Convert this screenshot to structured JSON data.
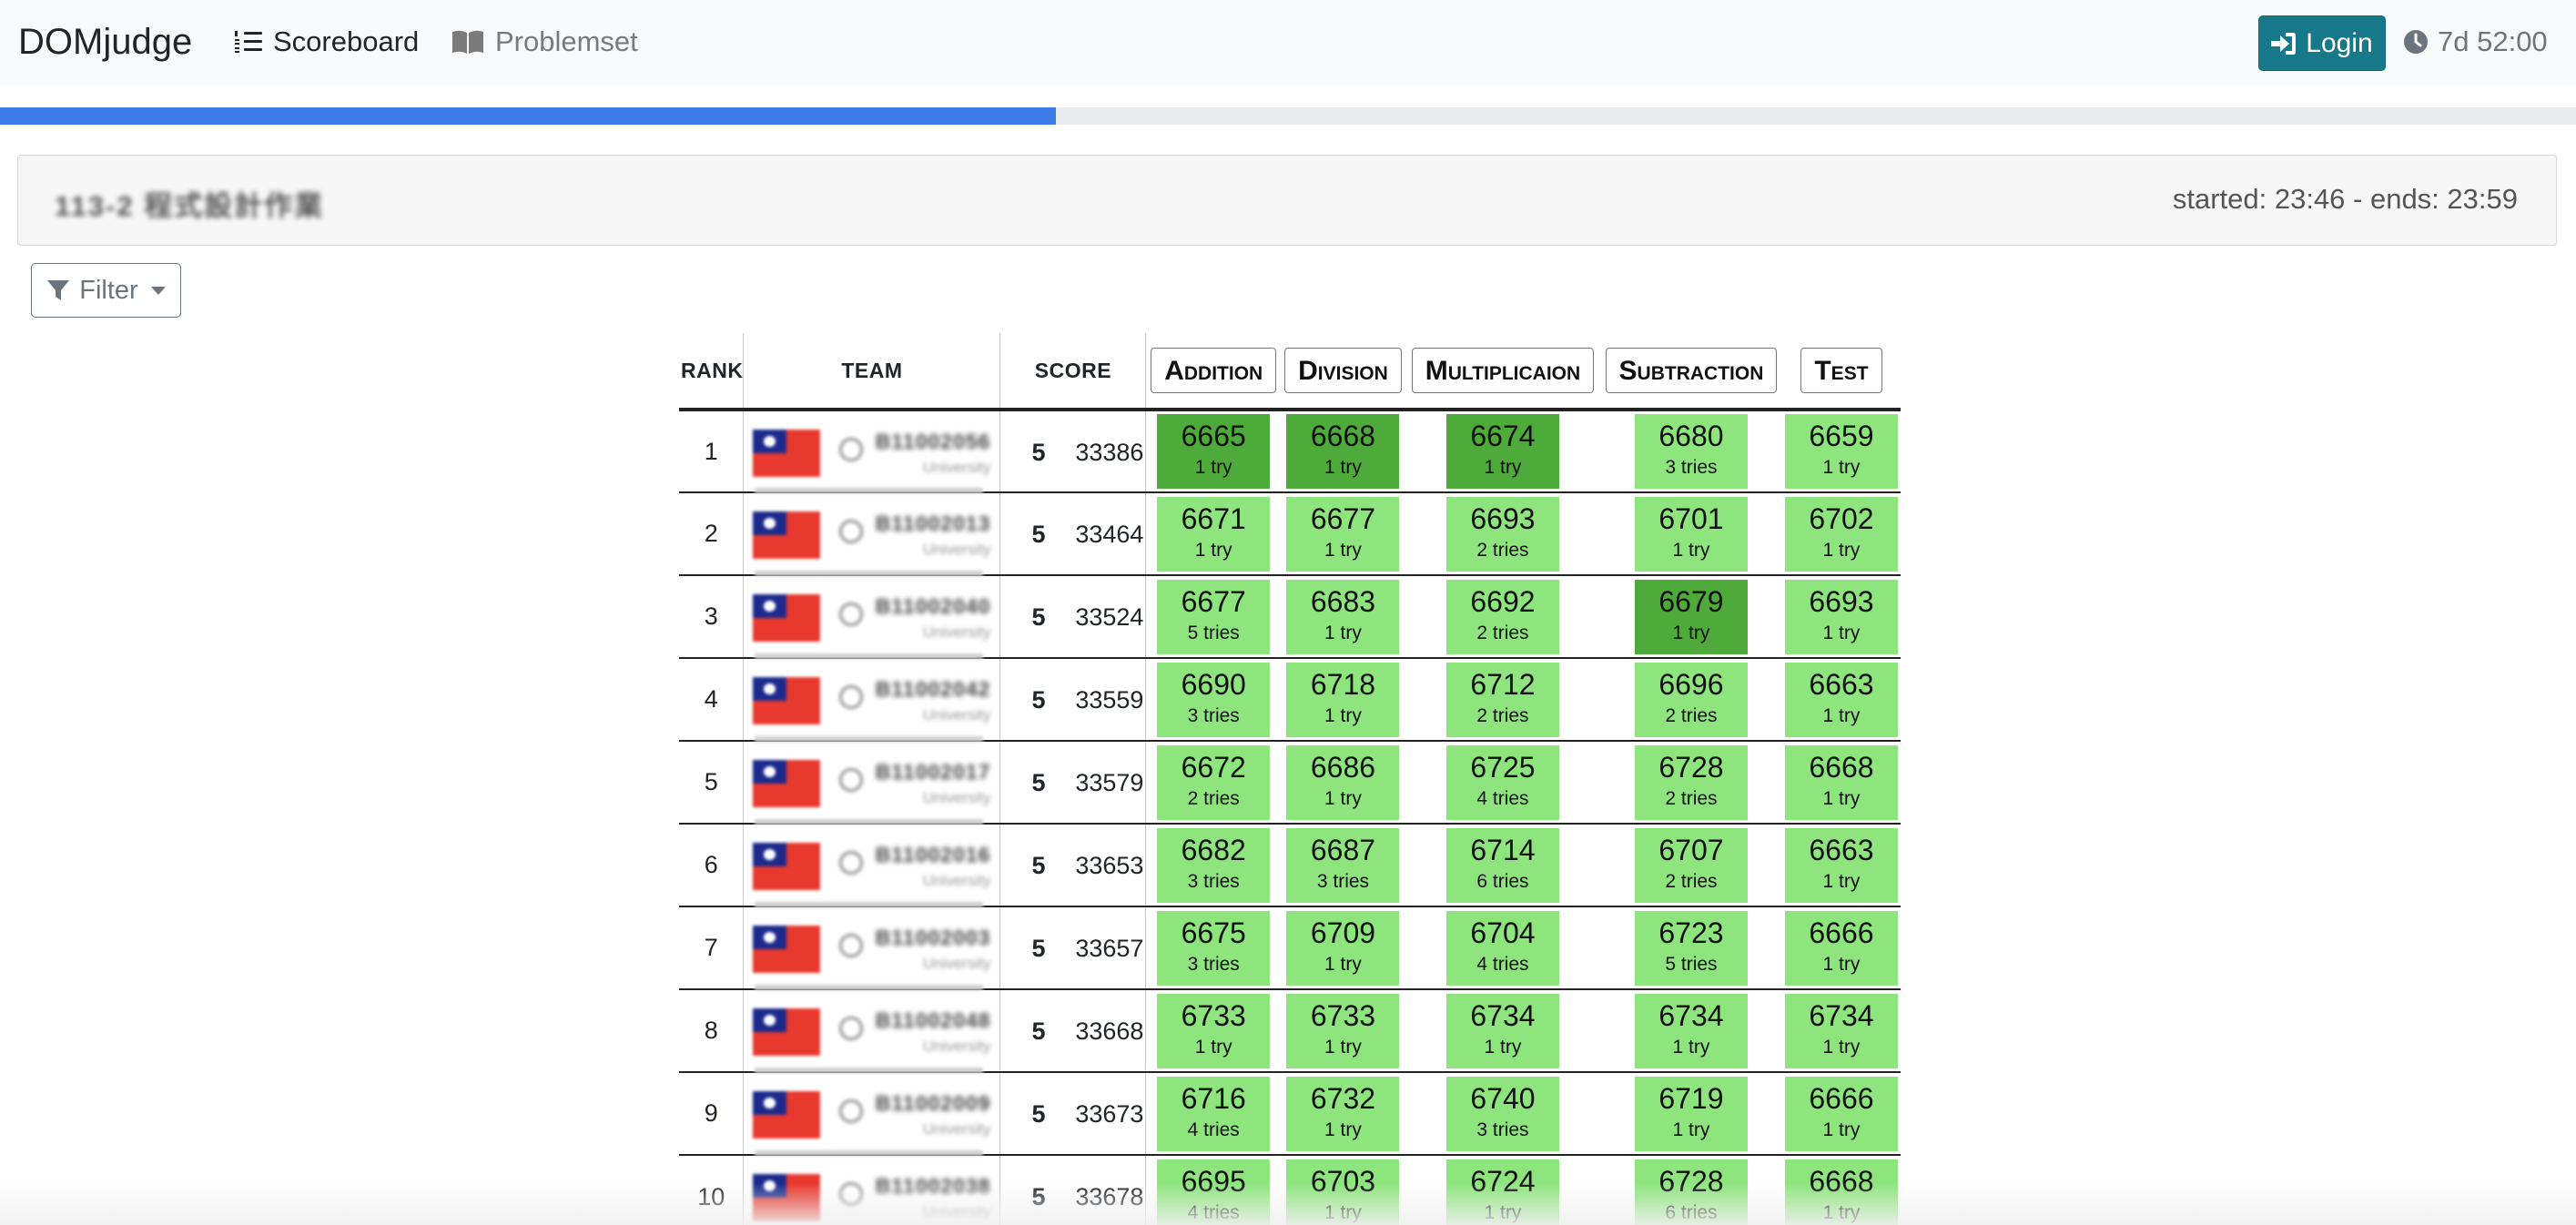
{
  "nav": {
    "brand": "DOMjudge",
    "scoreboard_label": "Scoreboard",
    "problemset_label": "Problemset",
    "login_label": "Login",
    "clock_text": "7d 52:00"
  },
  "progress": {
    "fraction": 0.41
  },
  "contest": {
    "name": "113-2 程式設計作業",
    "time_text": "started: 23:46 - ends: 23:59"
  },
  "filter": {
    "label": "Filter"
  },
  "table": {
    "headers": {
      "rank": "RANK",
      "team": "TEAM",
      "score": "SCORE"
    },
    "problems": [
      "Addition",
      "Division",
      "Multiplicaion",
      "Subtraction",
      "Test"
    ],
    "problem_col_widths": [
      148,
      137,
      214,
      200,
      130
    ],
    "rows": [
      {
        "rank": "1",
        "team": "B11002056",
        "uni": "University",
        "solved": "5",
        "penalty": "33386",
        "cells": [
          {
            "time": "6665",
            "tries": "1 try",
            "first": true
          },
          {
            "time": "6668",
            "tries": "1 try",
            "first": true
          },
          {
            "time": "6674",
            "tries": "1 try",
            "first": true
          },
          {
            "time": "6680",
            "tries": "3 tries",
            "first": false
          },
          {
            "time": "6659",
            "tries": "1 try",
            "first": false
          }
        ]
      },
      {
        "rank": "2",
        "team": "B11002013",
        "uni": "University",
        "solved": "5",
        "penalty": "33464",
        "cells": [
          {
            "time": "6671",
            "tries": "1 try",
            "first": false
          },
          {
            "time": "6677",
            "tries": "1 try",
            "first": false
          },
          {
            "time": "6693",
            "tries": "2 tries",
            "first": false
          },
          {
            "time": "6701",
            "tries": "1 try",
            "first": false
          },
          {
            "time": "6702",
            "tries": "1 try",
            "first": false
          }
        ]
      },
      {
        "rank": "3",
        "team": "B11002040",
        "uni": "University",
        "solved": "5",
        "penalty": "33524",
        "cells": [
          {
            "time": "6677",
            "tries": "5 tries",
            "first": false
          },
          {
            "time": "6683",
            "tries": "1 try",
            "first": false
          },
          {
            "time": "6692",
            "tries": "2 tries",
            "first": false
          },
          {
            "time": "6679",
            "tries": "1 try",
            "first": true
          },
          {
            "time": "6693",
            "tries": "1 try",
            "first": false
          }
        ]
      },
      {
        "rank": "4",
        "team": "B11002042",
        "uni": "University",
        "solved": "5",
        "penalty": "33559",
        "cells": [
          {
            "time": "6690",
            "tries": "3 tries",
            "first": false
          },
          {
            "time": "6718",
            "tries": "1 try",
            "first": false
          },
          {
            "time": "6712",
            "tries": "2 tries",
            "first": false
          },
          {
            "time": "6696",
            "tries": "2 tries",
            "first": false
          },
          {
            "time": "6663",
            "tries": "1 try",
            "first": false
          }
        ]
      },
      {
        "rank": "5",
        "team": "B11002017",
        "uni": "University",
        "solved": "5",
        "penalty": "33579",
        "cells": [
          {
            "time": "6672",
            "tries": "2 tries",
            "first": false
          },
          {
            "time": "6686",
            "tries": "1 try",
            "first": false
          },
          {
            "time": "6725",
            "tries": "4 tries",
            "first": false
          },
          {
            "time": "6728",
            "tries": "2 tries",
            "first": false
          },
          {
            "time": "6668",
            "tries": "1 try",
            "first": false
          }
        ]
      },
      {
        "rank": "6",
        "team": "B11002016",
        "uni": "University",
        "solved": "5",
        "penalty": "33653",
        "cells": [
          {
            "time": "6682",
            "tries": "3 tries",
            "first": false
          },
          {
            "time": "6687",
            "tries": "3 tries",
            "first": false
          },
          {
            "time": "6714",
            "tries": "6 tries",
            "first": false
          },
          {
            "time": "6707",
            "tries": "2 tries",
            "first": false
          },
          {
            "time": "6663",
            "tries": "1 try",
            "first": false
          }
        ]
      },
      {
        "rank": "7",
        "team": "B11002003",
        "uni": "University",
        "solved": "5",
        "penalty": "33657",
        "cells": [
          {
            "time": "6675",
            "tries": "3 tries",
            "first": false
          },
          {
            "time": "6709",
            "tries": "1 try",
            "first": false
          },
          {
            "time": "6704",
            "tries": "4 tries",
            "first": false
          },
          {
            "time": "6723",
            "tries": "5 tries",
            "first": false
          },
          {
            "time": "6666",
            "tries": "1 try",
            "first": false
          }
        ]
      },
      {
        "rank": "8",
        "team": "B11002048",
        "uni": "University",
        "solved": "5",
        "penalty": "33668",
        "cells": [
          {
            "time": "6733",
            "tries": "1 try",
            "first": false
          },
          {
            "time": "6733",
            "tries": "1 try",
            "first": false
          },
          {
            "time": "6734",
            "tries": "1 try",
            "first": false
          },
          {
            "time": "6734",
            "tries": "1 try",
            "first": false
          },
          {
            "time": "6734",
            "tries": "1 try",
            "first": false
          }
        ]
      },
      {
        "rank": "9",
        "team": "B11002009",
        "uni": "University",
        "solved": "5",
        "penalty": "33673",
        "cells": [
          {
            "time": "6716",
            "tries": "4 tries",
            "first": false
          },
          {
            "time": "6732",
            "tries": "1 try",
            "first": false
          },
          {
            "time": "6740",
            "tries": "3 tries",
            "first": false
          },
          {
            "time": "6719",
            "tries": "1 try",
            "first": false
          },
          {
            "time": "6666",
            "tries": "1 try",
            "first": false
          }
        ]
      },
      {
        "rank": "10",
        "team": "B11002038",
        "uni": "University",
        "solved": "5",
        "penalty": "33678",
        "cells": [
          {
            "time": "6695",
            "tries": "4 tries",
            "first": false
          },
          {
            "time": "6703",
            "tries": "1 try",
            "first": false
          },
          {
            "time": "6724",
            "tries": "1 try",
            "first": false
          },
          {
            "time": "6728",
            "tries": "6 tries",
            "first": false
          },
          {
            "time": "6668",
            "tries": "1 try",
            "first": false
          }
        ]
      }
    ]
  },
  "colors": {
    "nav_bg": "#f8f9fa",
    "progress_fill": "#3c7ae6",
    "login_bg": "#17788a",
    "solved": "#8ee57e",
    "first_solve": "#4faa3c"
  }
}
